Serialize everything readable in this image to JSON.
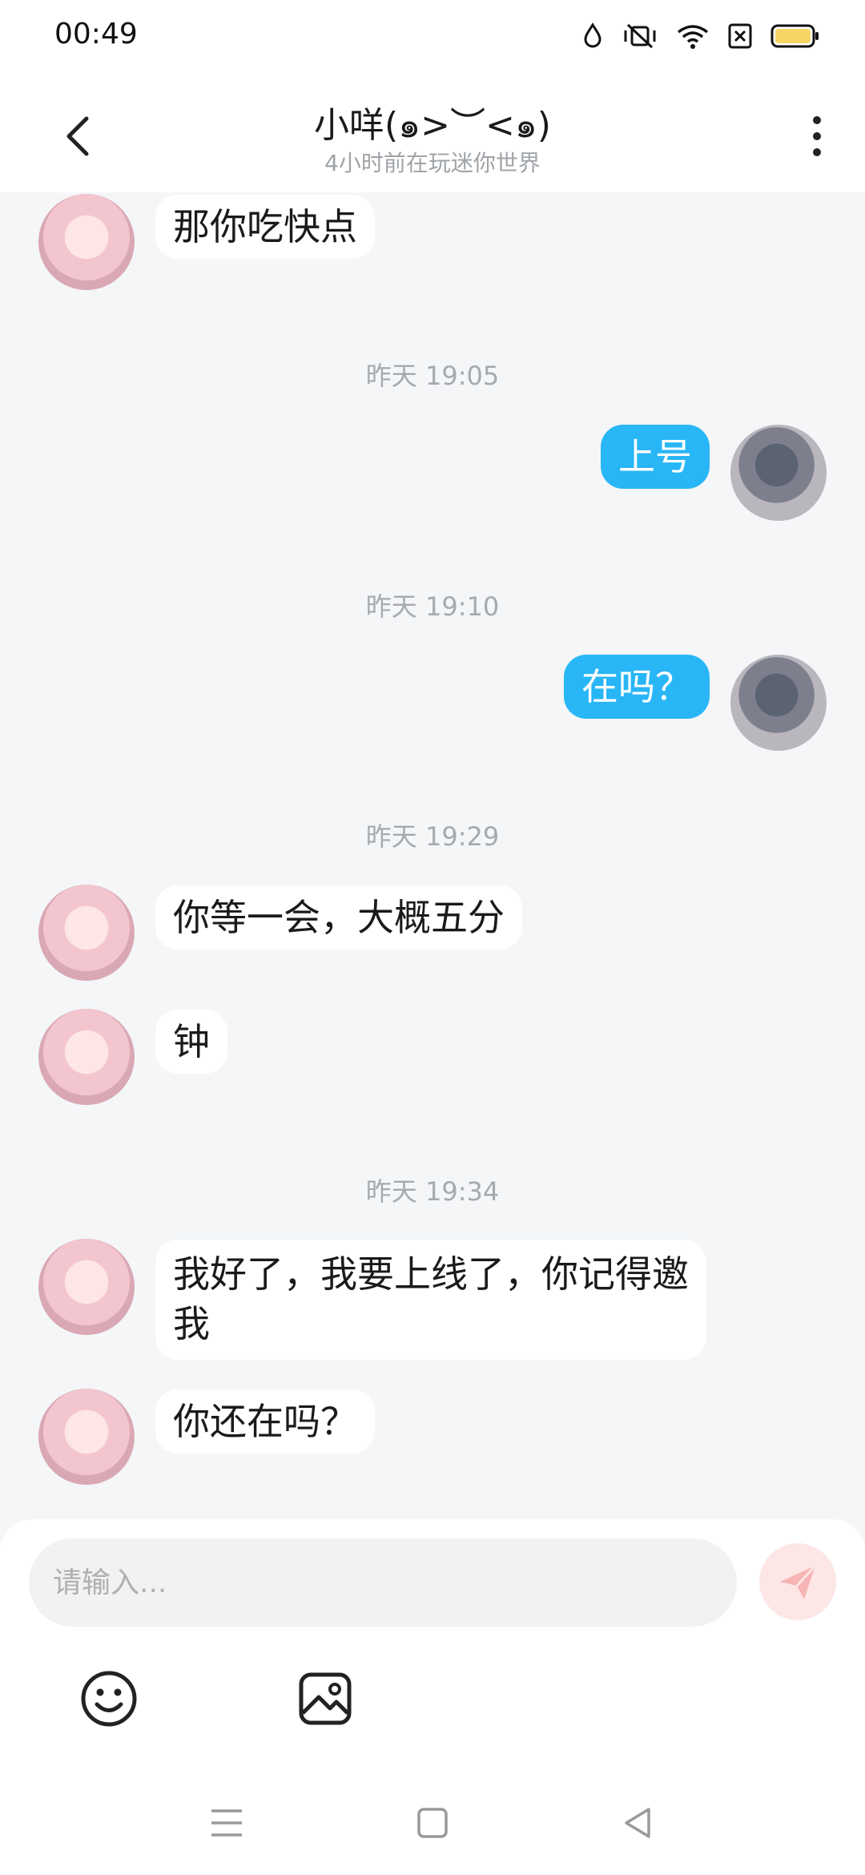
{
  "status_bar": {
    "time": "00:49",
    "icons": [
      "water-drop-icon",
      "vibrate-mute-icon",
      "wifi-icon",
      "sim-off-icon",
      "battery-icon"
    ],
    "battery_color": "#f7d565"
  },
  "header": {
    "title": "小咩(๑>︶<๑)",
    "subtitle": "4小时前在玩迷你世界",
    "back_icon": "chevron-left-icon",
    "more_icon": "more-vertical-icon"
  },
  "messages": [
    {
      "type": "in",
      "text": "那你吃快点"
    },
    {
      "type": "time",
      "text": "昨天 19:05"
    },
    {
      "type": "out",
      "text": "上号"
    },
    {
      "type": "time",
      "text": "昨天 19:10"
    },
    {
      "type": "out",
      "text": "在吗？"
    },
    {
      "type": "time",
      "text": "昨天 19:29"
    },
    {
      "type": "in",
      "text": "你等一会，大概五分"
    },
    {
      "type": "in",
      "text": "钟"
    },
    {
      "type": "time",
      "text": "昨天 19:34"
    },
    {
      "type": "in",
      "text": "我好了，我要上线了，你记得邀\n我"
    },
    {
      "type": "in",
      "text": "你还在吗？"
    }
  ],
  "composer": {
    "placeholder": "请输入...",
    "send_icon": "send-icon",
    "tools": [
      "emoji-icon",
      "image-icon"
    ]
  },
  "colors": {
    "outgoing_bubble": "#29b6f6",
    "incoming_bubble": "#ffffff",
    "background": "#f4f6f8",
    "send_button": "#fde6e6"
  },
  "nav_bar": {
    "icons": [
      "menu-icon",
      "home-square-icon",
      "back-triangle-icon"
    ]
  }
}
